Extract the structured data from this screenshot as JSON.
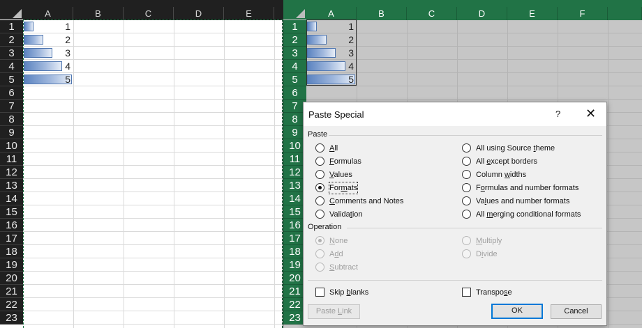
{
  "columns_left": [
    "A",
    "B",
    "C",
    "D",
    "E"
  ],
  "columns_right": [
    "A",
    "B",
    "C",
    "D",
    "E",
    "F"
  ],
  "rows": [
    "1",
    "2",
    "3",
    "4",
    "5",
    "6",
    "7",
    "8",
    "9",
    "10",
    "11",
    "12",
    "13",
    "14",
    "15",
    "16",
    "17",
    "18",
    "19",
    "20",
    "21",
    "22",
    "23"
  ],
  "data_values": [
    "1",
    "2",
    "3",
    "4",
    "5"
  ],
  "data_bar_fractions": [
    0.2,
    0.4,
    0.6,
    0.8,
    1.0
  ],
  "colors": {
    "excel_green": "#217346",
    "dark_header": "#202020",
    "dialog_bg": "#f0f0f0",
    "default_button_border": "#0078d7"
  },
  "dialog": {
    "title": "Paste Special",
    "help": "?",
    "close": "✕",
    "paste_group": "Paste",
    "paste_options_left": [
      "All",
      "Formulas",
      "Values",
      "Formats",
      "Comments and Notes",
      "Validation"
    ],
    "paste_options_right": [
      "All using Source theme",
      "All except borders",
      "Column widths",
      "Formulas and number formats",
      "Values and number formats",
      "All merging conditional formats"
    ],
    "paste_selected": "Formats",
    "operation_group": "Operation",
    "operation_options_left": [
      "None",
      "Add",
      "Subtract"
    ],
    "operation_options_right": [
      "Multiply",
      "Divide"
    ],
    "operation_selected": "None",
    "skip_blanks": "Skip blanks",
    "transpose": "Transpose",
    "paste_link": "Paste Link",
    "ok": "OK",
    "cancel": "Cancel"
  }
}
